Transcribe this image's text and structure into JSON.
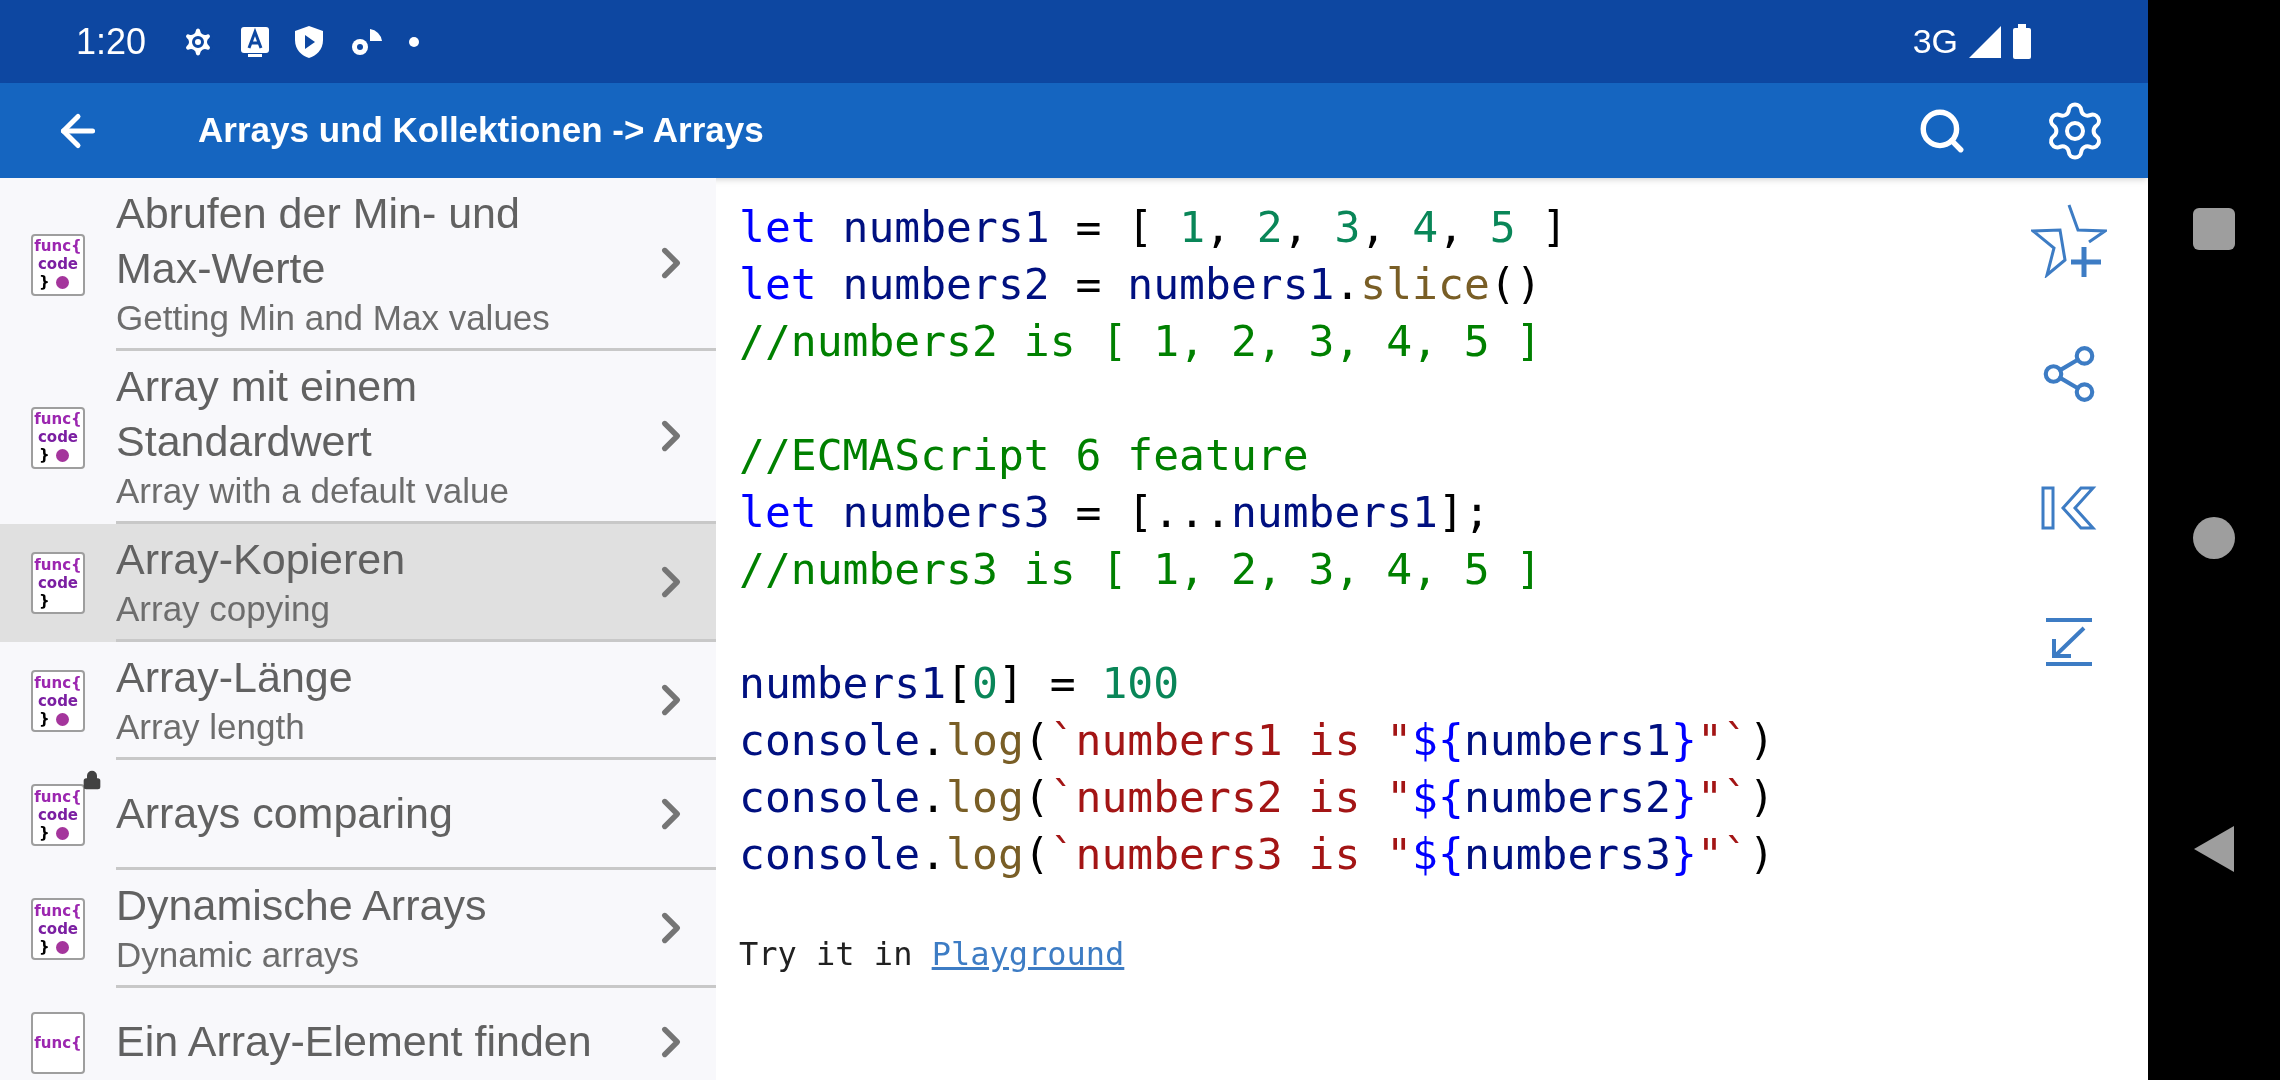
{
  "status_bar": {
    "time": "1:20",
    "network": "3G"
  },
  "app_bar": {
    "title": "Arrays und Kollektionen -> Arrays"
  },
  "list": {
    "items": [
      {
        "title": "Abrufen der Min- und Max-Werte",
        "subtitle": "Getting Min and Max values",
        "selected": false,
        "locked": false,
        "dot": true,
        "icon": {
          "top": "func{",
          "middle": "code",
          "bottom": "}"
        }
      },
      {
        "title": "Array mit einem Standardwert",
        "subtitle": "Array with a default value",
        "selected": false,
        "locked": false,
        "dot": true,
        "icon": {
          "top": "func{",
          "middle": "code",
          "bottom": "}"
        }
      },
      {
        "title": "Array-Kopieren",
        "subtitle": "Array copying",
        "selected": true,
        "locked": false,
        "dot": false,
        "icon": {
          "top": "func{",
          "middle": "code",
          "bottom": "}"
        }
      },
      {
        "title": "Array-Länge",
        "subtitle": "Array length",
        "selected": false,
        "locked": false,
        "dot": true,
        "icon": {
          "top": "func{",
          "middle": "code",
          "bottom": "}"
        }
      },
      {
        "title": "Arrays comparing",
        "selected": false,
        "locked": true,
        "dot": true,
        "icon": {
          "top": "func{",
          "middle": "code",
          "bottom": "}"
        }
      },
      {
        "title": "Dynamische Arrays",
        "subtitle": "Dynamic arrays",
        "selected": false,
        "locked": false,
        "dot": true,
        "icon": {
          "top": "func{",
          "middle": "code",
          "bottom": "}"
        }
      },
      {
        "title": "Ein Array-Element finden",
        "selected": false,
        "locked": false,
        "icon": {
          "top": "func{"
        }
      }
    ]
  },
  "code": {
    "blocks": [
      [
        [
          {
            "kind": "kw",
            "text": "let "
          },
          {
            "kind": "id",
            "text": "numbers1"
          },
          {
            "kind": "pn",
            "text": " = [ "
          },
          {
            "kind": "num",
            "text": "1"
          },
          {
            "kind": "pn",
            "text": ", "
          },
          {
            "kind": "num",
            "text": "2"
          },
          {
            "kind": "pn",
            "text": ", "
          },
          {
            "kind": "num",
            "text": "3"
          },
          {
            "kind": "pn",
            "text": ", "
          },
          {
            "kind": "num",
            "text": "4"
          },
          {
            "kind": "pn",
            "text": ", "
          },
          {
            "kind": "num",
            "text": "5"
          },
          {
            "kind": "pn",
            "text": " ]"
          }
        ],
        [
          {
            "kind": "kw",
            "text": "let "
          },
          {
            "kind": "id",
            "text": "numbers2"
          },
          {
            "kind": "pn",
            "text": " = "
          },
          {
            "kind": "id",
            "text": "numbers1"
          },
          {
            "kind": "pn",
            "text": "."
          },
          {
            "kind": "fn",
            "text": "slice"
          },
          {
            "kind": "pn",
            "text": "()"
          }
        ],
        [
          {
            "kind": "cm",
            "text": "//numbers2 is [ 1, 2, 3, 4, 5 ]"
          }
        ]
      ],
      [
        [
          {
            "kind": "cm",
            "text": "//ECMAScript 6 feature"
          }
        ],
        [
          {
            "kind": "kw",
            "text": "let "
          },
          {
            "kind": "id",
            "text": "numbers3"
          },
          {
            "kind": "pn",
            "text": " = [..."
          },
          {
            "kind": "id",
            "text": "numbers1"
          },
          {
            "kind": "pn",
            "text": "];"
          }
        ],
        [
          {
            "kind": "cm",
            "text": "//numbers3 is [ 1, 2, 3, 4, 5 ]"
          }
        ]
      ],
      [
        [
          {
            "kind": "id",
            "text": "numbers1"
          },
          {
            "kind": "pn",
            "text": "["
          },
          {
            "kind": "num",
            "text": "0"
          },
          {
            "kind": "pn",
            "text": "] = "
          },
          {
            "kind": "num",
            "text": "100"
          }
        ],
        [
          {
            "kind": "id",
            "text": "console"
          },
          {
            "kind": "pn",
            "text": "."
          },
          {
            "kind": "fn",
            "text": "log"
          },
          {
            "kind": "pn",
            "text": "("
          },
          {
            "kind": "str",
            "text": "`numbers1 is \""
          },
          {
            "kind": "kw",
            "text": "${"
          },
          {
            "kind": "id",
            "text": "numbers1"
          },
          {
            "kind": "kw",
            "text": "}"
          },
          {
            "kind": "str",
            "text": "\"`"
          },
          {
            "kind": "pn",
            "text": ")"
          }
        ],
        [
          {
            "kind": "id",
            "text": "console"
          },
          {
            "kind": "pn",
            "text": "."
          },
          {
            "kind": "fn",
            "text": "log"
          },
          {
            "kind": "pn",
            "text": "("
          },
          {
            "kind": "str",
            "text": "`numbers2 is \""
          },
          {
            "kind": "kw",
            "text": "${"
          },
          {
            "kind": "id",
            "text": "numbers2"
          },
          {
            "kind": "kw",
            "text": "}"
          },
          {
            "kind": "str",
            "text": "\"`"
          },
          {
            "kind": "pn",
            "text": ")"
          }
        ],
        [
          {
            "kind": "id",
            "text": "console"
          },
          {
            "kind": "pn",
            "text": "."
          },
          {
            "kind": "fn",
            "text": "log"
          },
          {
            "kind": "pn",
            "text": "("
          },
          {
            "kind": "str",
            "text": "`numbers3 is \""
          },
          {
            "kind": "kw",
            "text": "${"
          },
          {
            "kind": "id",
            "text": "numbers3"
          },
          {
            "kind": "kw",
            "text": "}"
          },
          {
            "kind": "str",
            "text": "\"`"
          },
          {
            "kind": "pn",
            "text": ")"
          }
        ]
      ]
    ],
    "try_text": "Try it in",
    "try_link": "Playground"
  }
}
